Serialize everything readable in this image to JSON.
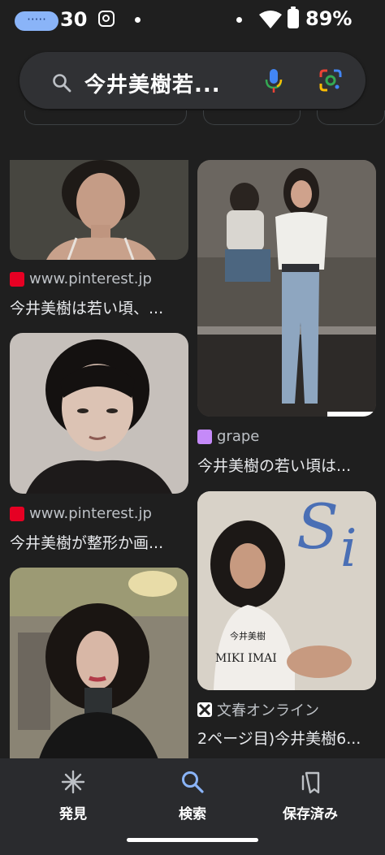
{
  "status": {
    "time": "30",
    "battery": "89%"
  },
  "search": {
    "query": "今井美樹若..."
  },
  "results": [
    {
      "source": "www.pinterest.jp",
      "title": "今井美樹は若い頃、..."
    },
    {
      "source": "grape",
      "title": "今井美樹の若い頃は..."
    },
    {
      "source": "www.pinterest.jp",
      "title": "今井美樹が整形か画..."
    },
    {
      "source": "文春オンライン",
      "title": "2ページ目)今井美樹6..."
    }
  ],
  "magazine_text": {
    "name_jp": "今井美樹",
    "name_en": "MIKI IMAI"
  },
  "nav": {
    "discover": "発見",
    "search": "検索",
    "saved": "保存済み"
  },
  "colors": {
    "background": "#1f1f1f",
    "accent": "#8ab4f8",
    "pinterest": "#e60023",
    "grape": "#c58af9"
  }
}
